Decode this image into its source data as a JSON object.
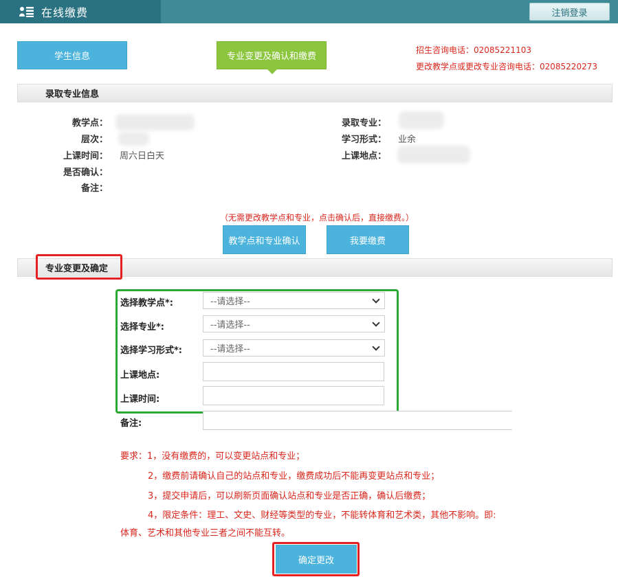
{
  "header": {
    "title": "在线缴费",
    "logout_label": "注销登录",
    "icon": "user-list-icon"
  },
  "tabs": {
    "student_info": "学生信息",
    "change_confirm_pay": "专业变更及确认和缴费"
  },
  "contacts": {
    "enroll_phone": "招生咨询电话：02085221103",
    "change_phone": "更改教学点或更改专业咨询电话：02085220273"
  },
  "admission": {
    "section_title": "录取专业信息",
    "labels": {
      "site": "教学点：",
      "level": "层次：",
      "time": "上课时间：",
      "confirmed": "是否确认：",
      "remark": "备注：",
      "major": "录取专业：",
      "mode": "学习形式：",
      "place": "上课地点："
    },
    "values": {
      "time": "周六日白天",
      "mode": "业余"
    }
  },
  "action": {
    "note": "（无需更改教学点和专业，点击确认后，直接缴费。）",
    "confirm_label": "教学点和专业确认",
    "pay_label": "我要缴费"
  },
  "change": {
    "section_title": "专业变更及确定",
    "labels": {
      "site": "选择教学点*:",
      "major": "选择专业*:",
      "mode": "选择学习形式*:",
      "place": "上课地点:",
      "time": "上课时间:",
      "remark": "备注:"
    },
    "placeholder_option": "--请选择--"
  },
  "requirements": {
    "r1": "要求：1，没有缴费的，可以变更站点和专业；",
    "r2": "2，缴费前请确认自己的站点和专业，缴费成功后不能再变更站点和专业；",
    "r3": "3，提交申请后，可以刷新页面确认站点和专业是否正确，确认后缴费；",
    "r4a": "4，限定条件：理工、文史、财经等类型的专业，不能转体育和艺术类，其他不影响。即:",
    "r4b": "体育、艺术和其他专业三者之间不能互转。"
  },
  "submit_label": "确定更改",
  "colors": {
    "header": "#3e8a97",
    "accent_blue": "#4bb3dc",
    "accent_green": "#8cc63e",
    "red": "#d9261c"
  }
}
